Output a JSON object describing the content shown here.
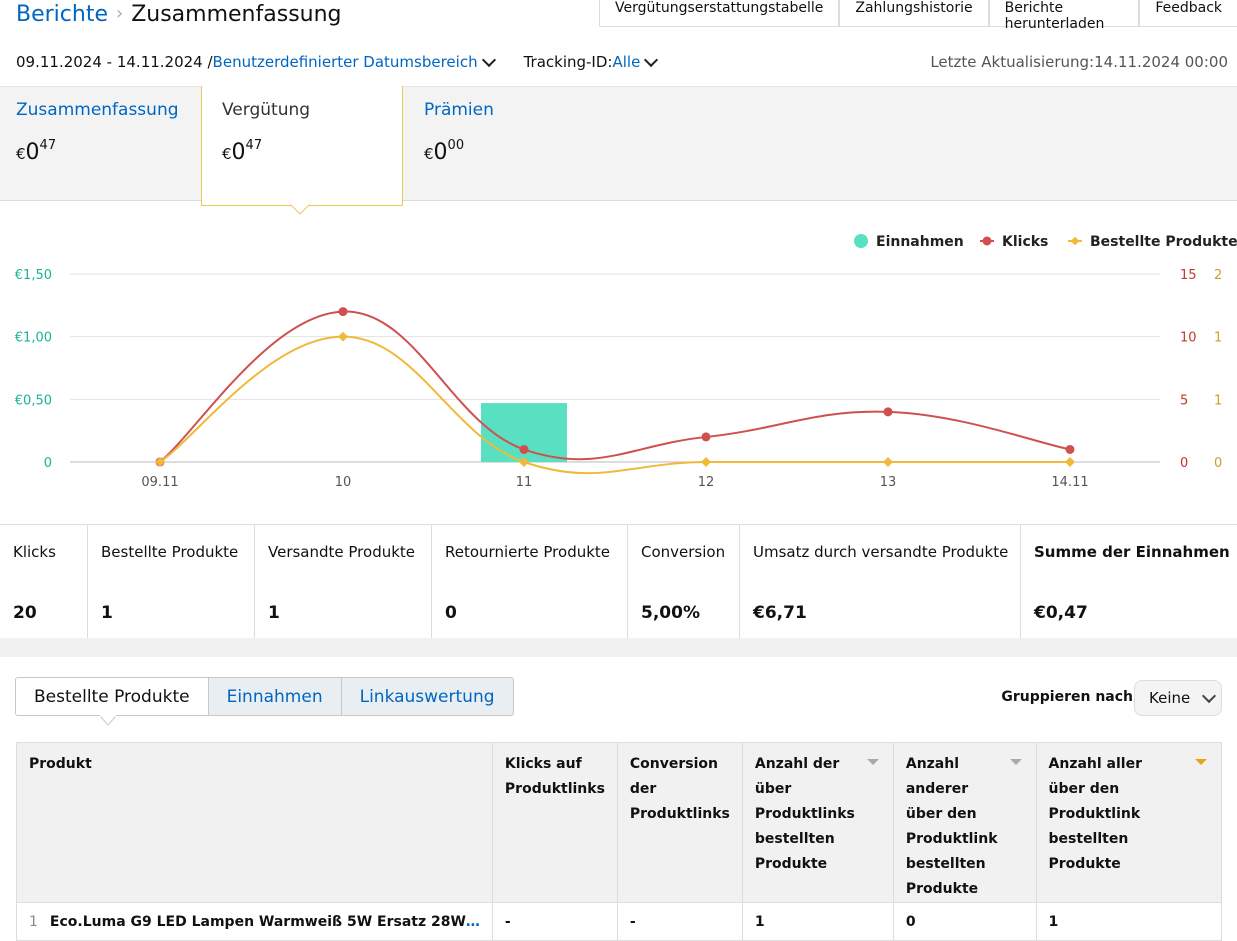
{
  "breadcrumb": {
    "parent": "Berichte",
    "current": "Zusammenfassung"
  },
  "top_tabs": [
    "Vergütungserstattungstabelle",
    "Zahlungshistorie",
    "Berichte herunterladen",
    "Feedback"
  ],
  "filters": {
    "date_range": "09.11.2024 - 14.11.2024 /",
    "date_link": "Benutzerdefinierter Datumsbereich",
    "tracking_label": "Tracking-ID:",
    "tracking_value": "Alle",
    "last_update": "Letzte Aktualisierung:14.11.2024 00:00"
  },
  "summary_tabs": [
    {
      "label": "Zusammenfassung",
      "currency": "€",
      "whole": "0",
      "cents": "47"
    },
    {
      "label": "Vergütung",
      "currency": "€",
      "whole": "0",
      "cents": "47"
    },
    {
      "label": "Prämien",
      "currency": "€",
      "whole": "0",
      "cents": "00"
    }
  ],
  "chart_data": {
    "type": "bar+line",
    "categories": [
      "09.11",
      "10",
      "11",
      "12",
      "13",
      "14.11"
    ],
    "legend_position": "top-right",
    "y_left": {
      "ticks": [
        "0",
        "€0,50",
        "€1,00",
        "€1,50"
      ],
      "range": [
        0,
        1.5
      ],
      "color": "#1ab394"
    },
    "y_right_1": {
      "ticks": [
        "0",
        "5",
        "10",
        "15"
      ],
      "range": [
        0,
        15
      ],
      "color": "#c0392b"
    },
    "y_right_2": {
      "ticks": [
        "0",
        "1",
        "1",
        "2"
      ],
      "range": [
        0,
        1.5
      ],
      "color": "#c9a227"
    },
    "series": [
      {
        "name": "Einnahmen",
        "kind": "bar",
        "axis": "left",
        "color": "#59e0c3",
        "values": [
          0,
          0,
          0.47,
          0,
          0,
          0
        ]
      },
      {
        "name": "Klicks",
        "kind": "line",
        "axis": "right_1",
        "color": "#d05050",
        "values": [
          0,
          12,
          1,
          2,
          4,
          1
        ]
      },
      {
        "name": "Bestellte Produkte",
        "kind": "line",
        "axis": "right_2",
        "color": "#f0b93a",
        "values": [
          0,
          1,
          0,
          0,
          0,
          0
        ]
      }
    ],
    "grid": true
  },
  "metrics": [
    {
      "label": "Klicks",
      "value": "20"
    },
    {
      "label": "Bestellte Produkte",
      "value": "1"
    },
    {
      "label": "Versandte Produkte",
      "value": "1"
    },
    {
      "label": "Retournierte Produkte",
      "value": "0"
    },
    {
      "label": "Conversion",
      "value": "5,00%"
    },
    {
      "label": "Umsatz durch versandte Produkte",
      "value": "€6,71"
    },
    {
      "label": "Summe der Einnahmen",
      "value": "€0,47"
    }
  ],
  "bottom_tabs": [
    "Bestellte Produkte",
    "Einnahmen",
    "Linkauswertung"
  ],
  "group_by": {
    "label": "Gruppieren nach",
    "value": "Keine"
  },
  "table": {
    "headers": [
      "Produkt",
      "Klicks auf Produktlinks",
      "Conversion der Produktlinks",
      "Anzahl der über Produktlinks bestellten Produkte",
      "Anzahl anderer über den Produktlink bestellten Produkte",
      "Anzahl aller über den Produktlink bestellten Produkte"
    ],
    "rows": [
      {
        "index": "1",
        "product": "Eco.Luma G9 LED Lampen Warmweiß 5W Ersatz 28W",
        "ellipsis": "…",
        "clicks": "-",
        "conversion": "-",
        "ordered": "1",
        "other": "0",
        "all": "1"
      }
    ]
  },
  "colors": {
    "link": "#0066c0",
    "accent_border": "#f0c85a"
  }
}
